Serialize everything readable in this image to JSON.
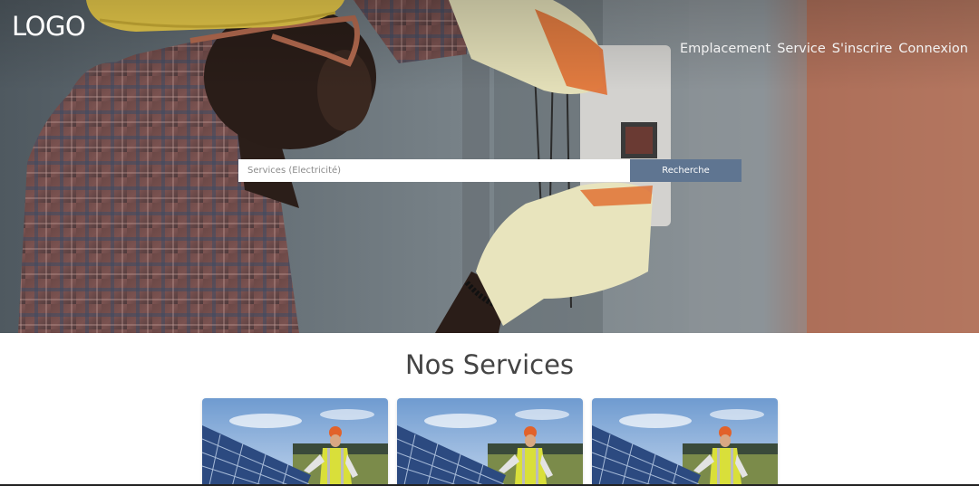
{
  "header": {
    "logo_text": "LOGO",
    "nav": [
      {
        "label": "Emplacement"
      },
      {
        "label": "Service"
      },
      {
        "label": "S'inscrire"
      },
      {
        "label": "Connexion"
      }
    ]
  },
  "search": {
    "placeholder": "Services (Électricité)",
    "button_label": "Recherche",
    "button_color": "#5f7591"
  },
  "services": {
    "title": "Nos Services",
    "cards": [
      {
        "image": "solar-panel-worker-image"
      },
      {
        "image": "solar-panel-worker-image"
      },
      {
        "image": "solar-panel-worker-image"
      }
    ]
  }
}
